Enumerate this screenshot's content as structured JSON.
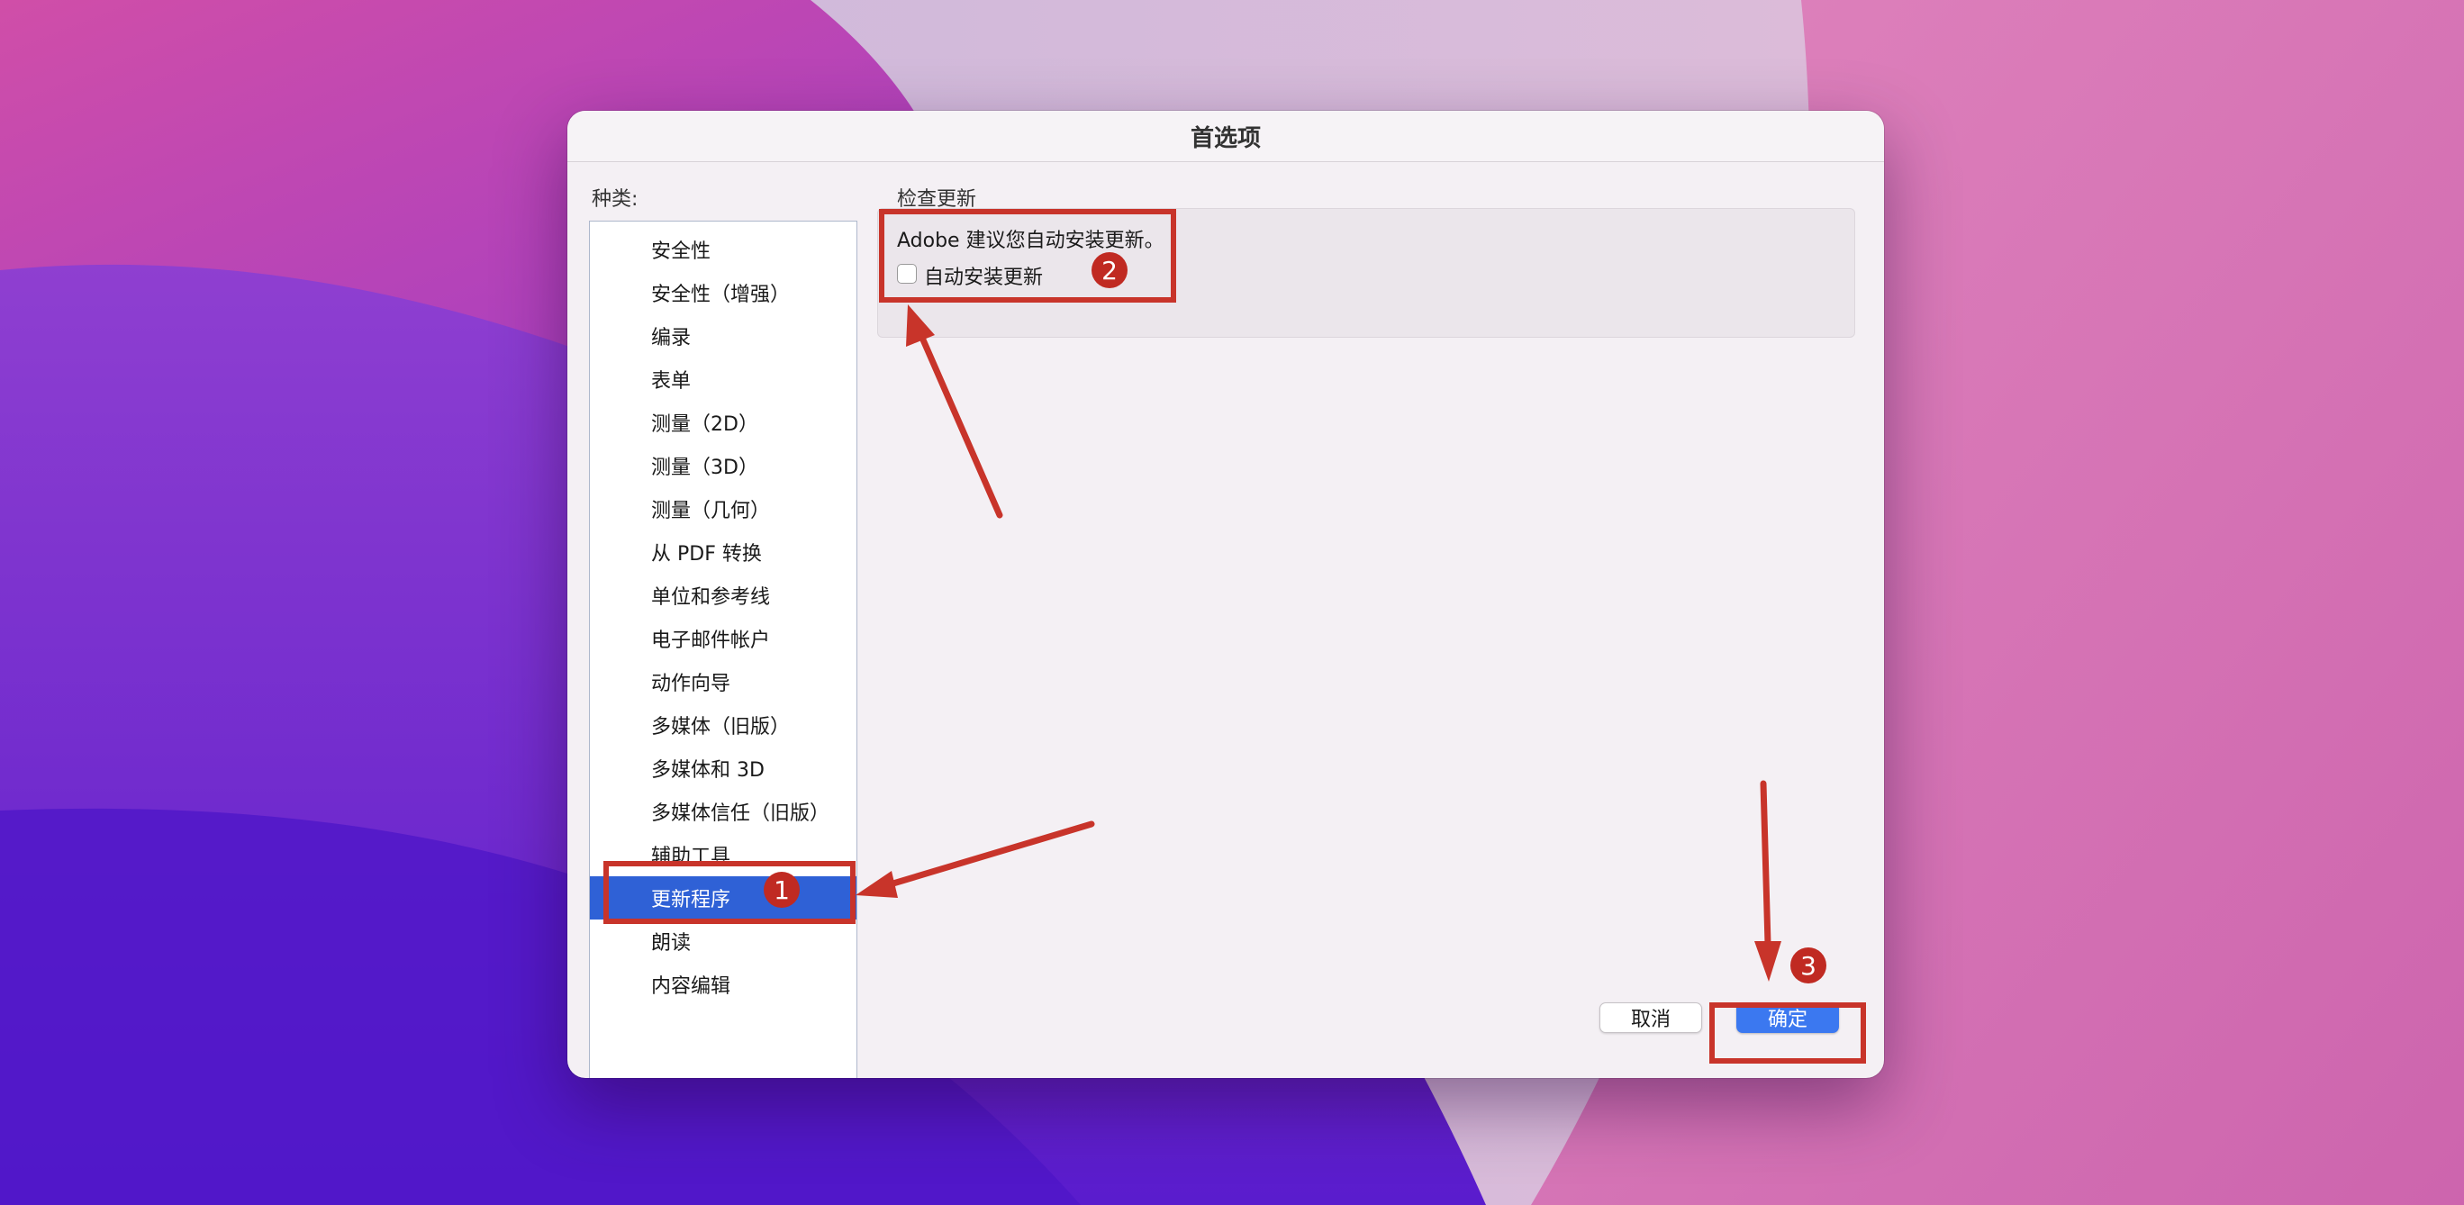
{
  "dialog": {
    "title": "首选项",
    "category_label": "种类:",
    "categories": [
      {
        "label": "安全性"
      },
      {
        "label": "安全性（增强）"
      },
      {
        "label": "编录"
      },
      {
        "label": "表单"
      },
      {
        "label": "测量（2D）"
      },
      {
        "label": "测量（3D）"
      },
      {
        "label": "测量（几何）"
      },
      {
        "label": "从 PDF 转换"
      },
      {
        "label": "单位和参考线"
      },
      {
        "label": "电子邮件帐户"
      },
      {
        "label": "动作向导"
      },
      {
        "label": "多媒体（旧版）"
      },
      {
        "label": "多媒体和 3D"
      },
      {
        "label": "多媒体信任（旧版）"
      },
      {
        "label": "辅助工具"
      },
      {
        "label": "更新程序",
        "selected": true
      },
      {
        "label": "朗读"
      },
      {
        "label": "内容编辑"
      }
    ],
    "section_title": "检查更新",
    "recommend_text": "Adobe 建议您自动安装更新。",
    "auto_install_label": "自动安装更新",
    "auto_install_checked": false,
    "cancel_label": "取消",
    "ok_label": "确定"
  },
  "annotations": {
    "badge_1": "1",
    "badge_2": "2",
    "badge_3": "3"
  },
  "colors": {
    "selection": "#2f61d6",
    "annotation": "#c8342a",
    "primary_button": "#3b78f0"
  }
}
